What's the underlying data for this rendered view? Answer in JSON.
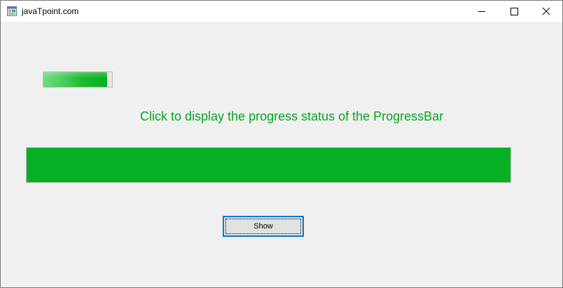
{
  "window": {
    "title": "javaTpoint.com",
    "app_icon": "form-app-icon",
    "controls": {
      "minimize_icon": "minimize-icon",
      "maximize_icon": "maximize-icon",
      "close_icon": "close-icon"
    }
  },
  "progress_small": {
    "value_fraction": 0.93,
    "fill_color": "#06b025"
  },
  "status_label": {
    "text": "Click to display the progress status of the ProgressBar",
    "color": "#06a51e"
  },
  "progress_large": {
    "value_fraction": 1.0,
    "fill_color": "#06b025"
  },
  "show_button": {
    "label": "Show"
  }
}
